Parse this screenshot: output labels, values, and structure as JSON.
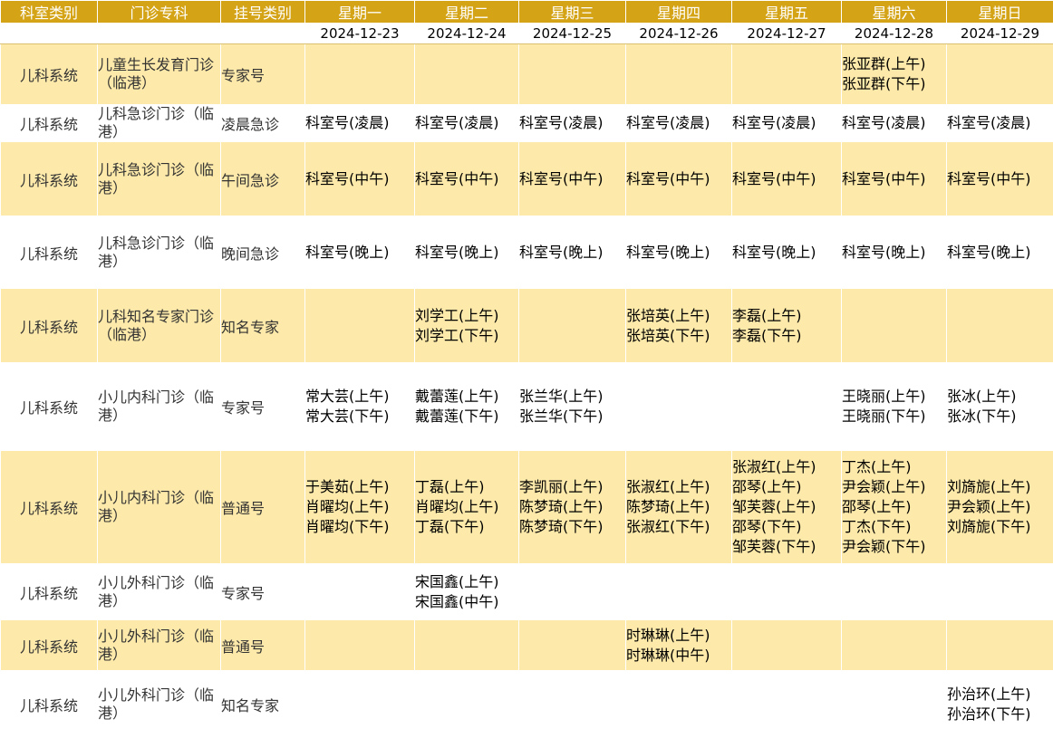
{
  "headers": [
    "科室类别",
    "门诊专科",
    "挂号类别",
    "星期一",
    "星期二",
    "星期三",
    "星期四",
    "星期五",
    "星期六",
    "星期日"
  ],
  "dates": [
    "2024-12-23",
    "2024-12-24",
    "2024-12-25",
    "2024-12-26",
    "2024-12-27",
    "2024-12-28",
    "2024-12-29"
  ],
  "rows": [
    {
      "dept": "儿科系统",
      "clinic": "儿童生长发育门诊（临港）",
      "type": "专家号",
      "days": [
        [],
        [],
        [],
        [],
        [],
        [
          "张亚群(上午)",
          "张亚群(下午)"
        ],
        []
      ]
    },
    {
      "dept": "儿科系统",
      "clinic": "儿科急诊门诊（临港）",
      "type": "凌晨急诊",
      "days": [
        [
          "科室号(凌晨)"
        ],
        [
          "科室号(凌晨)"
        ],
        [
          "科室号(凌晨)"
        ],
        [
          "科室号(凌晨)"
        ],
        [
          "科室号(凌晨)"
        ],
        [
          "科室号(凌晨)"
        ],
        [
          "科室号(凌晨)"
        ]
      ]
    },
    {
      "dept": "儿科系统",
      "clinic": "儿科急诊门诊（临港）",
      "type": "午间急诊",
      "days": [
        [
          "科室号(中午)"
        ],
        [
          "科室号(中午)"
        ],
        [
          "科室号(中午)"
        ],
        [
          "科室号(中午)"
        ],
        [
          "科室号(中午)"
        ],
        [
          "科室号(中午)"
        ],
        [
          "科室号(中午)"
        ]
      ]
    },
    {
      "dept": "儿科系统",
      "clinic": "儿科急诊门诊（临港）",
      "type": "晚间急诊",
      "days": [
        [
          "科室号(晚上)"
        ],
        [
          "科室号(晚上)"
        ],
        [
          "科室号(晚上)"
        ],
        [
          "科室号(晚上)"
        ],
        [
          "科室号(晚上)"
        ],
        [
          "科室号(晚上)"
        ],
        [
          "科室号(晚上)"
        ]
      ]
    },
    {
      "dept": "儿科系统",
      "clinic": "儿科知名专家门诊（临港）",
      "type": "知名专家",
      "days": [
        [],
        [
          "刘学工(上午)",
          "刘学工(下午)"
        ],
        [],
        [
          "张培英(上午)",
          "张培英(下午)"
        ],
        [
          "李磊(上午)",
          "李磊(下午)"
        ],
        [],
        []
      ]
    },
    {
      "dept": "儿科系统",
      "clinic": "小儿内科门诊（临港）",
      "type": "专家号",
      "days": [
        [
          "常大芸(上午)",
          "常大芸(下午)"
        ],
        [
          "戴蕾莲(上午)",
          "戴蕾莲(下午)"
        ],
        [
          "张兰华(上午)",
          "张兰华(下午)"
        ],
        [],
        [],
        [
          "王晓丽(上午)",
          "王晓丽(下午)"
        ],
        [
          "张冰(上午)",
          "张冰(下午)"
        ]
      ]
    },
    {
      "dept": "儿科系统",
      "clinic": "小儿内科门诊（临港）",
      "type": "普通号",
      "days": [
        [
          "于美茹(上午)",
          "肖曜均(上午)",
          "肖曜均(下午)"
        ],
        [
          "丁磊(上午)",
          "肖曜均(上午)",
          "丁磊(下午)"
        ],
        [
          "李凯丽(上午)",
          "陈梦琦(上午)",
          "陈梦琦(下午)"
        ],
        [
          "张淑红(上午)",
          "陈梦琦(上午)",
          "张淑红(下午)"
        ],
        [
          "张淑红(上午)",
          "邵琴(上午)",
          "邹芙蓉(上午)",
          "邵琴(下午)",
          "邹芙蓉(下午)"
        ],
        [
          "丁杰(上午)",
          "尹会颖(上午)",
          "邵琴(上午)",
          "丁杰(下午)",
          "尹会颖(下午)"
        ],
        [
          "刘旖旎(上午)",
          "尹会颖(上午)",
          "刘旖旎(下午)"
        ]
      ]
    },
    {
      "dept": "儿科系统",
      "clinic": "小儿外科门诊（临港）",
      "type": "专家号",
      "days": [
        [],
        [
          "宋国鑫(上午)",
          "宋国鑫(中午)"
        ],
        [],
        [],
        [],
        [],
        []
      ]
    },
    {
      "dept": "儿科系统",
      "clinic": "小儿外科门诊（临港）",
      "type": "普通号",
      "days": [
        [],
        [],
        [],
        [
          "时琳琳(上午)",
          "时琳琳(中午)"
        ],
        [],
        [],
        []
      ]
    },
    {
      "dept": "儿科系统",
      "clinic": "小儿外科门诊（临港）",
      "type": "知名专家",
      "days": [
        [],
        [],
        [],
        [],
        [],
        [],
        [
          "孙治环(上午)",
          "孙治环(下午)"
        ]
      ]
    }
  ]
}
